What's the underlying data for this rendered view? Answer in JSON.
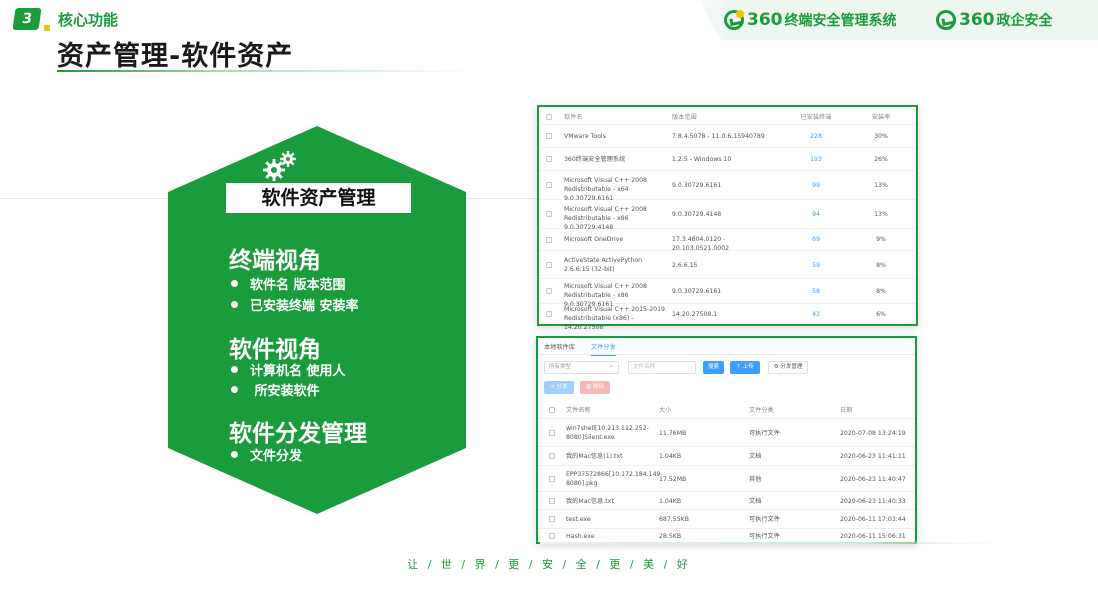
{
  "header": {
    "section_number": "3",
    "section_label": "核心功能",
    "page_title": "资产管理-软件资产",
    "logo_primary_num": "360",
    "logo_primary_text": "终端安全管理系统",
    "logo_secondary_num": "360",
    "logo_secondary_text": "政企安全"
  },
  "hexagon": {
    "title": "软件资产管理",
    "groups": [
      {
        "title": "终端视角",
        "items": [
          "软件名 版本范围",
          "已安装终端 安装率"
        ]
      },
      {
        "title": "软件视角",
        "items": [
          "计算机名 使用人",
          " 所安装软件"
        ]
      },
      {
        "title": "软件分发管理",
        "items": [
          "文件分发"
        ]
      }
    ]
  },
  "software_table": {
    "headers": {
      "name": "软件名",
      "version": "版本范围",
      "installed": "已安装终端",
      "rate": "安装率"
    },
    "rows": [
      {
        "name": "VMware Tools",
        "version": "7.8.4.5078 - 11.0.6.15940789",
        "installed": "228",
        "rate": "30%"
      },
      {
        "name": "360终端安全管理系统",
        "version": "1.2.5 - Windows 10",
        "installed": "193",
        "rate": "26%"
      },
      {
        "name": "Microsoft Visual C++ 2008 Redistributable - x64 9.0.30729.6161",
        "version": "9.0.30729.6161",
        "installed": "99",
        "rate": "13%"
      },
      {
        "name": "Microsoft Visual C++ 2008 Redistributable - x86 9.0.30729.4148",
        "version": "9.0.30729.4148",
        "installed": "94",
        "rate": "13%"
      },
      {
        "name": "Microsoft OneDrive",
        "version": "17.3.4604.0120 - 20.103.0521.0002",
        "installed": "69",
        "rate": "9%"
      },
      {
        "name": "ActiveState ActivePython 2.6.6.15 (32-bit)",
        "version": "2.6.6.15",
        "installed": "59",
        "rate": "8%"
      },
      {
        "name": "Microsoft Visual C++ 2008 Redistributable - x86 9.0.30729.6161",
        "version": "9.0.30729.6161",
        "installed": "58",
        "rate": "8%"
      },
      {
        "name": "Microsoft Visual C++ 2015-2019 Redistributable (x86) - 14.20.27508",
        "version": "14.20.27508.1",
        "installed": "43",
        "rate": "6%"
      }
    ]
  },
  "file_dist": {
    "tabs": [
      "本地软件库",
      "文件分发"
    ],
    "type_select": "所有类型",
    "name_placeholder": "文件名称",
    "search_label": "搜索",
    "upload_label": "上传",
    "dist_label": "分发管理",
    "share_label": "分发",
    "delete_label": "删除",
    "headers": {
      "name": "文件名称",
      "size": "大小",
      "category": "文件分类",
      "date": "日期"
    },
    "rows": [
      {
        "name": "win7shell[10.213.112.252-8080]Silent.exe",
        "size": "11.76MB",
        "category": "可执行文件",
        "date": "2020-07-08 13:24:19"
      },
      {
        "name": "我的Mac信息(1).txt",
        "size": "1.04KB",
        "category": "文档",
        "date": "2020-06-23 11:41:11"
      },
      {
        "name": "EPP37572866[10.172.184.149-8080].pkg",
        "size": "17.52MB",
        "category": "其他",
        "date": "2020-06-23 11:40:47"
      },
      {
        "name": "我的Mac信息.txt",
        "size": "1.04KB",
        "category": "文档",
        "date": "2020-06-23 11:40:33"
      },
      {
        "name": "test.exe",
        "size": "687.55KB",
        "category": "可执行文件",
        "date": "2020-06-11 17:03:44"
      },
      {
        "name": "Hash.exe",
        "size": "28.5KB",
        "category": "可执行文件",
        "date": "2020-06-11 15:06:31"
      }
    ]
  },
  "slogan": "让 / 世 / 界 / 更 / 安 / 全 / 更 / 美 / 好",
  "colors": {
    "brand_green": "#1a9b3c",
    "accent_yellow": "#f5c400",
    "link_blue": "#409eff"
  }
}
